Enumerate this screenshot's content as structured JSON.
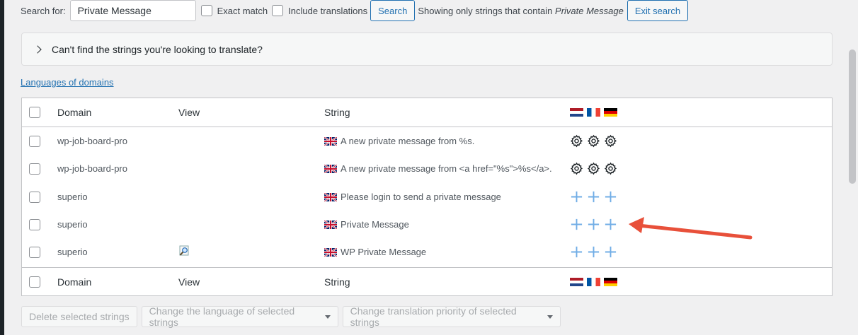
{
  "search": {
    "label": "Search for:",
    "value": "Private Message",
    "exact_match": "Exact match",
    "include_translations": "Include translations",
    "search_button": "Search",
    "showing_prefix": "Showing only strings that contain",
    "showing_term": "Private Message",
    "exit_button": "Exit search"
  },
  "notice": {
    "text": "Can't find the strings you're looking to translate?"
  },
  "languages_link": "Languages of domains",
  "table": {
    "headers": {
      "domain": "Domain",
      "view": "View",
      "string": "String"
    },
    "languages": [
      "nl",
      "fr",
      "de"
    ],
    "rows": [
      {
        "domain": "wp-job-board-pro",
        "view": "",
        "string": "A new private message from %s.",
        "status": "gear"
      },
      {
        "domain": "wp-job-board-pro",
        "view": "",
        "string": "A new private message from <a href=\"%s\">%s</a>.",
        "status": "gear"
      },
      {
        "domain": "superio",
        "view": "",
        "string": "Please login to send a private message",
        "status": "plus"
      },
      {
        "domain": "superio",
        "view": "",
        "string": "Private Message",
        "status": "plus"
      },
      {
        "domain": "superio",
        "view": "view-icon",
        "string": "WP Private Message",
        "status": "plus"
      }
    ]
  },
  "bulk": {
    "delete": "Delete selected strings",
    "change_language": "Change the language of selected strings",
    "change_priority": "Change translation priority of selected strings"
  },
  "colors": {
    "accent": "#2271b1",
    "arrow": "#e8503a",
    "plus": "#72aee6"
  }
}
